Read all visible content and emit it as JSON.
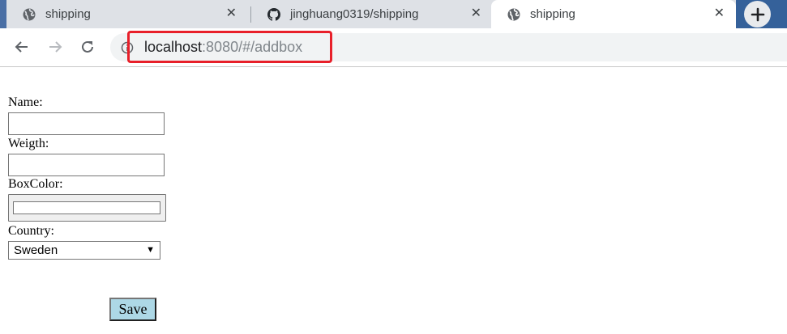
{
  "browser": {
    "tabs": [
      {
        "title": "shipping",
        "icon": "globe-icon",
        "close": "✕"
      },
      {
        "title": "jinghuang0319/shipping",
        "icon": "github-icon",
        "close": "✕"
      },
      {
        "title": "shipping",
        "icon": "globe-icon",
        "close": "✕",
        "active": true
      }
    ],
    "new_tab": "+",
    "url_host": "localhost",
    "url_rest": ":8080/#/addbox",
    "highlight_color": "#e8202a"
  },
  "form": {
    "name_label": "Name:",
    "name_value": "",
    "weight_label": "Weigth:",
    "weight_value": "",
    "boxcolor_label": "BoxColor:",
    "boxcolor_value": "#ffffff",
    "country_label": "Country:",
    "country_value": "Sweden",
    "save_label": "Save",
    "save_color": "#add8e6"
  }
}
